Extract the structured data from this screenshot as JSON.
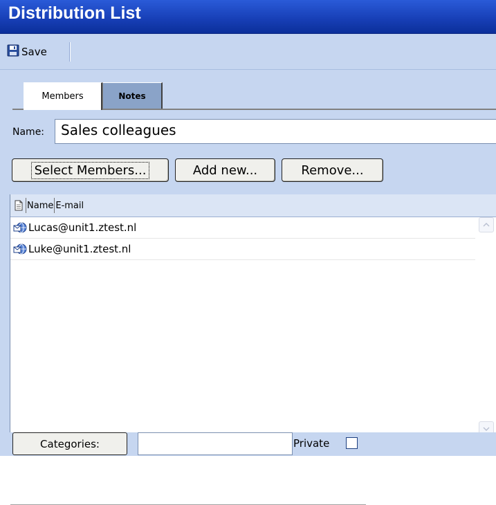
{
  "window": {
    "title": "Distribution List"
  },
  "toolbar": {
    "save_label": "Save",
    "save_icon": "floppy-disk-icon"
  },
  "tabs": [
    {
      "label": "Members",
      "active": true
    },
    {
      "label": "Notes",
      "active": false
    }
  ],
  "form": {
    "name_label": "Name:",
    "name_value": "Sales colleagues"
  },
  "buttons": {
    "select_members": "Select Members...",
    "add_new": "Add new...",
    "remove": "Remove..."
  },
  "list": {
    "columns": [
      "Name",
      "E-mail"
    ],
    "header_icon": "document-icon",
    "rows": [
      {
        "name": "Lucas@unit1.ztest.nl",
        "icon": "email-contact-icon"
      },
      {
        "name": "Luke@unit1.ztest.nl",
        "icon": "email-contact-icon"
      }
    ]
  },
  "footer": {
    "categories_label": "Categories:",
    "categories_value": "",
    "private_label": "Private",
    "private_checked": false
  },
  "colors": {
    "title_bar": "#1840b8",
    "panel_background": "#c6d6f0",
    "inactive_tab": "#8aa3c8"
  }
}
